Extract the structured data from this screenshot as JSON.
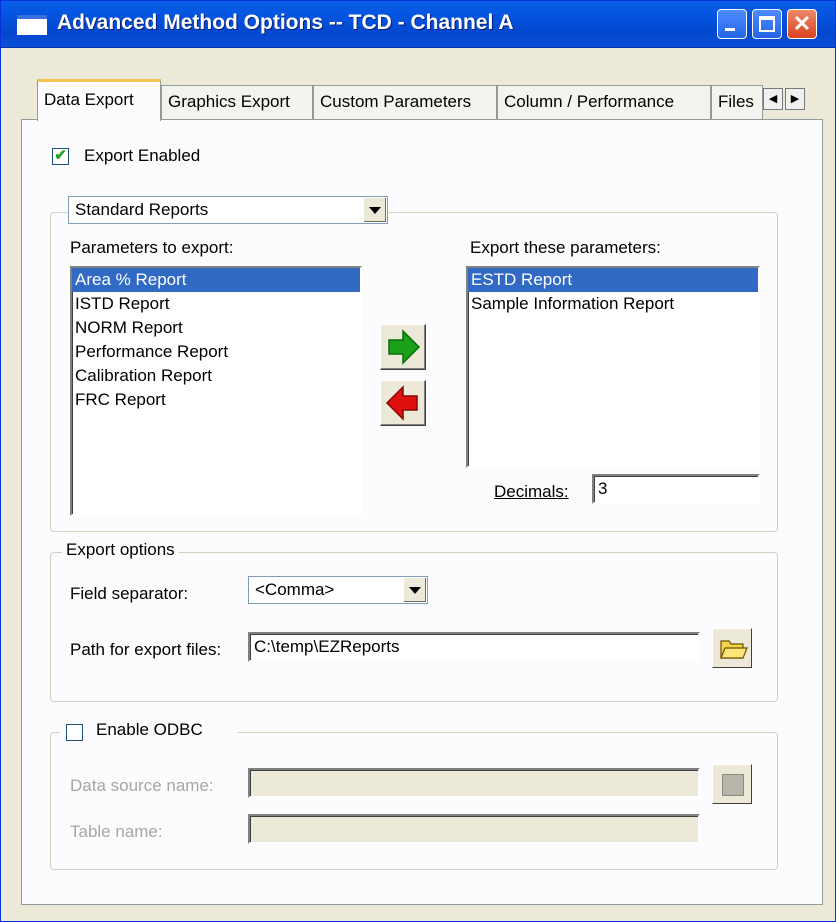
{
  "window": {
    "title": "Advanced Method Options -- TCD - Channel A",
    "controls": {
      "minimize": "minimize-icon",
      "maximize": "maximize-icon",
      "close": "close-icon"
    }
  },
  "tabs": [
    {
      "label": "Data Export",
      "active": true
    },
    {
      "label": "Graphics Export",
      "active": false
    },
    {
      "label": "Custom Parameters",
      "active": false
    },
    {
      "label": "Column / Performance",
      "active": false
    },
    {
      "label": "Files",
      "active": false
    }
  ],
  "export_enabled": {
    "label": "Export Enabled",
    "checked": true
  },
  "report_group": {
    "report_type": "Standard Reports",
    "available_label": "Parameters to export:",
    "available": [
      "Area % Report",
      "ISTD Report",
      "NORM Report",
      "Performance Report",
      "Calibration Report",
      "FRC Report"
    ],
    "available_selected": "Area % Report",
    "selected_label": "Export these parameters:",
    "selected": [
      "ESTD Report",
      "Sample Information Report"
    ],
    "selected_selected": "ESTD Report",
    "decimals_label": "Decimals:",
    "decimals_value": "3"
  },
  "export_options": {
    "legend": "Export options",
    "separator_label": "Field separator:",
    "separator_value": "<Comma>",
    "path_label": "Path for export files:",
    "path_value": "C:\\temp\\EZReports"
  },
  "odbc": {
    "label": "Enable ODBC",
    "checked": false,
    "dsn_label": "Data source name:",
    "dsn_value": "",
    "table_label": "Table name:",
    "table_value": ""
  },
  "colors": {
    "title_bar": "#0454e0",
    "face": "#ece9d8",
    "selection": "#316ac5",
    "add_arrow": "#1aa11a",
    "remove_arrow": "#e01010",
    "active_tab_accent": "#f0c44a"
  }
}
